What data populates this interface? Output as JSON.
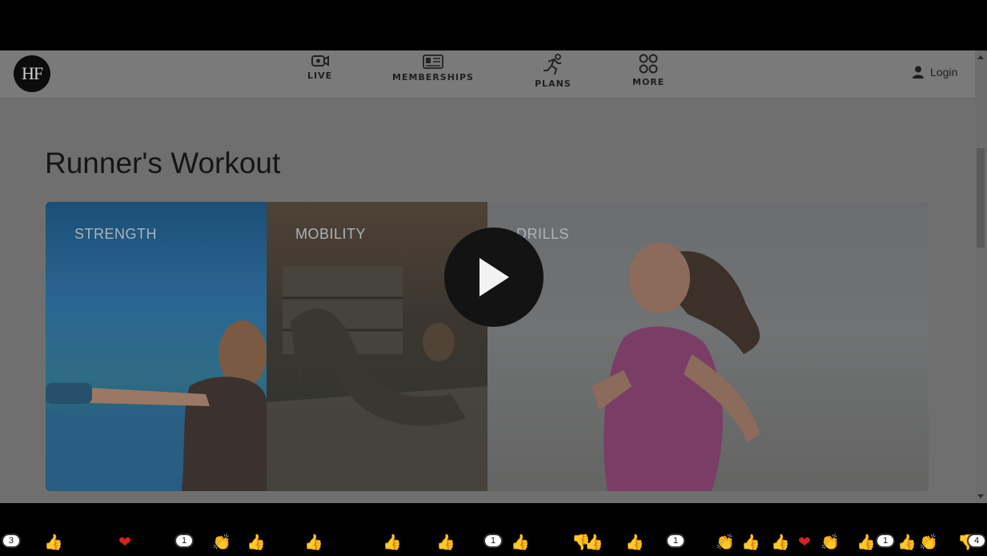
{
  "header": {
    "logo_text": "HF",
    "nav": [
      {
        "label": "LIVE",
        "icon": "video-camera-icon"
      },
      {
        "label": "MEMBERSHIPS",
        "icon": "membership-card-icon"
      },
      {
        "label": "PLANS",
        "icon": "runner-icon"
      },
      {
        "label": "MORE",
        "icon": "grid-icon"
      }
    ],
    "login_label": "Login",
    "login_icon": "user-icon"
  },
  "main": {
    "title": "Runner's Workout",
    "video": {
      "panels": [
        {
          "label": "STRENGTH"
        },
        {
          "label": "MOBILITY"
        },
        {
          "label": "DRILLS"
        }
      ],
      "play_icon": "play-icon"
    }
  },
  "reactions": {
    "bubble_counts": [
      "3",
      "1",
      "1",
      "1",
      "1",
      "4"
    ]
  },
  "colors": {
    "overlay": "#6f6f6f",
    "header": "#7a7a7a",
    "play_button": "#131313"
  }
}
